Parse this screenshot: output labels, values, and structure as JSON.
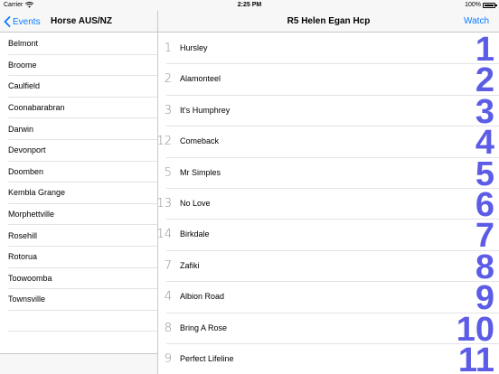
{
  "status": {
    "carrier": "Carrier",
    "time": "2:25 PM",
    "battery": "100%"
  },
  "left_nav": {
    "back_label": "Events",
    "title": "Horse AUS/NZ"
  },
  "right_nav": {
    "title": "R5 Helen Egan Hcp",
    "watch_label": "Watch"
  },
  "venues": [
    "Belmont",
    "Broome",
    "Caulfield",
    "Coonabarabran",
    "Darwin",
    "Devonport",
    "Doomben",
    "Kembla Grange",
    "Morphettville",
    "Rosehill",
    "Rotorua",
    "Toowoomba",
    "Townsville"
  ],
  "runners": [
    {
      "number": "1",
      "name": "Hursley",
      "position": "1"
    },
    {
      "number": "2",
      "name": "Alamonteel",
      "position": "2"
    },
    {
      "number": "3",
      "name": "It's Humphrey",
      "position": "3"
    },
    {
      "number": "12",
      "name": "Comeback",
      "position": "4"
    },
    {
      "number": "5",
      "name": "Mr Simples",
      "position": "5"
    },
    {
      "number": "13",
      "name": "No Love",
      "position": "6"
    },
    {
      "number": "14",
      "name": "Birkdale",
      "position": "7"
    },
    {
      "number": "7",
      "name": "Zafiki",
      "position": "8"
    },
    {
      "number": "4",
      "name": "Albion Road",
      "position": "9"
    },
    {
      "number": "8",
      "name": "Bring A Rose",
      "position": "10"
    },
    {
      "number": "9",
      "name": "Perfect Lifeline",
      "position": "11"
    }
  ],
  "colors": {
    "accent": "#0a7aff",
    "position": "#5c5ce6"
  }
}
